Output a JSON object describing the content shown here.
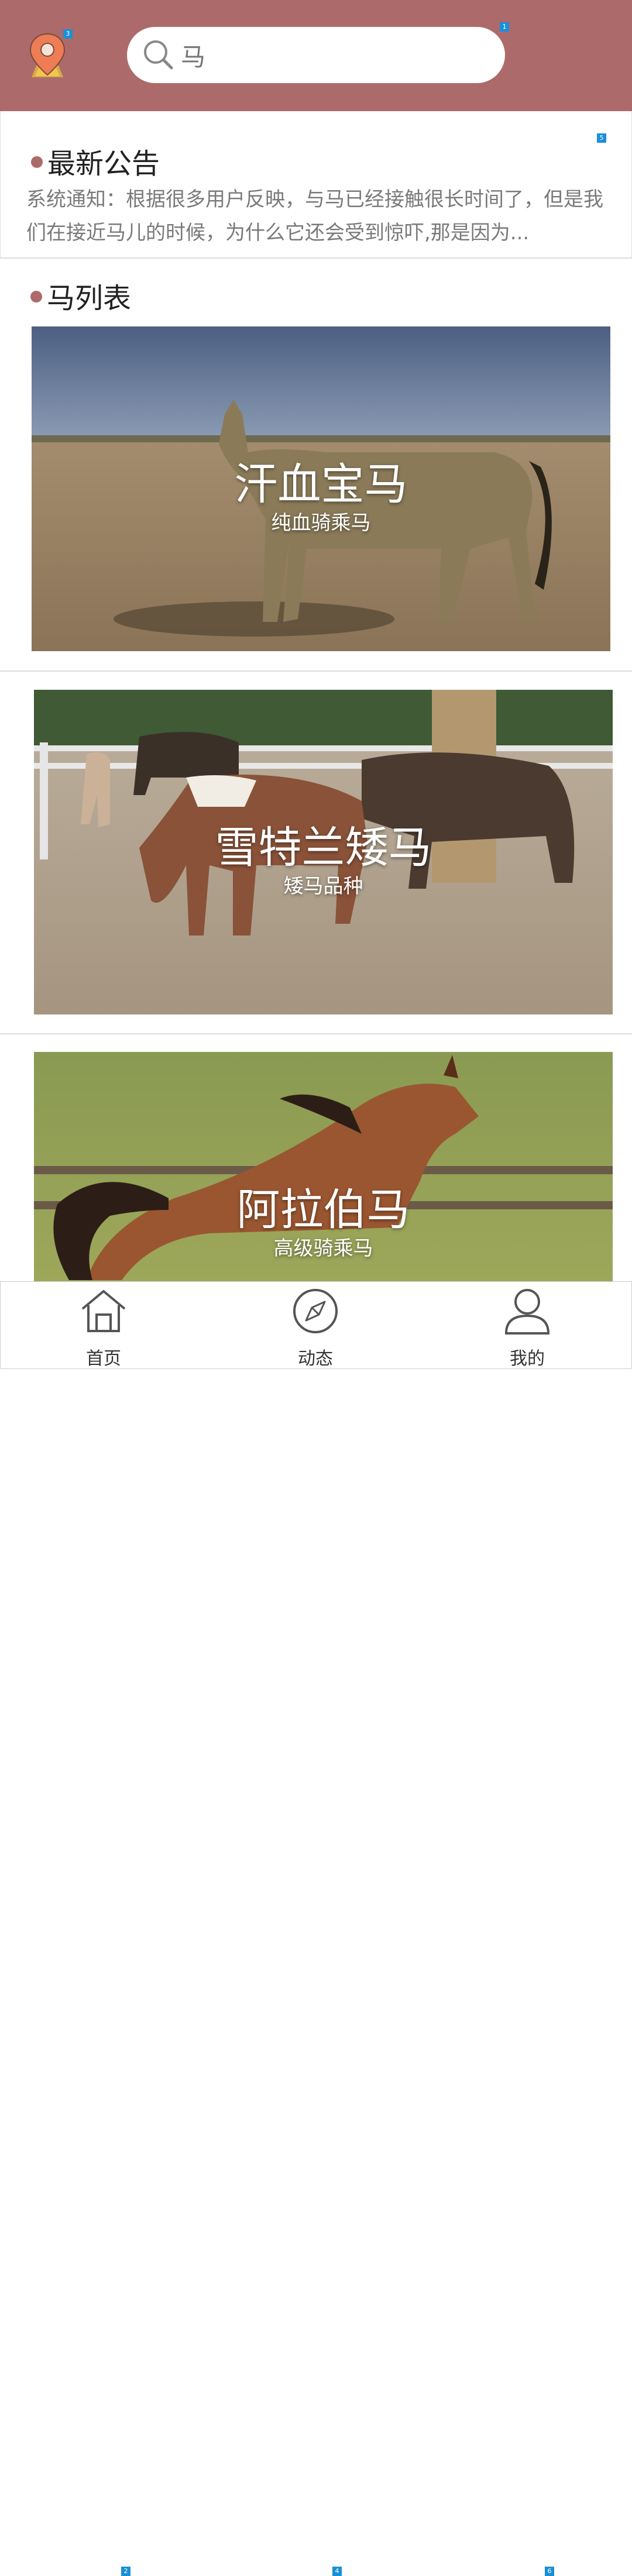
{
  "header": {
    "search_value": "马",
    "location_badge": "3",
    "search_badge": "1"
  },
  "notice": {
    "title": "最新公告",
    "badge": "5",
    "text": "系统通知：根据很多用户反映，与马已经接触很长时间了，但是我们在接近马儿的时候，为什么它还会受到惊吓,那是因为..."
  },
  "horse_list": {
    "title": "马列表",
    "items": [
      {
        "name": "汗血宝马",
        "subtitle": "纯血骑乘马"
      },
      {
        "name": "雪特兰矮马",
        "subtitle": "矮马品种"
      },
      {
        "name": "阿拉伯马",
        "subtitle": "高级骑乘马"
      }
    ]
  },
  "tabbar": {
    "items": [
      {
        "label": "首页",
        "icon": "home-icon",
        "badge": "2"
      },
      {
        "label": "动态",
        "icon": "compass-icon",
        "badge": "4"
      },
      {
        "label": "我的",
        "icon": "user-icon",
        "badge": "6"
      }
    ]
  },
  "colors": {
    "header_bg": "#ad6a6a",
    "accent_dot": "#ad6a6a",
    "badge": "#1a8fd8"
  }
}
